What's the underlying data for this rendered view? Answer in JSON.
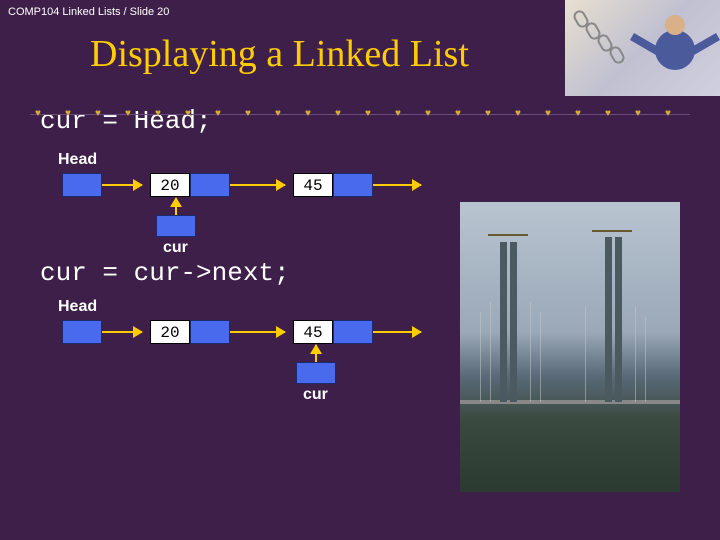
{
  "header": "COMP104 Linked Lists / Slide 20",
  "title": "Displaying a Linked List",
  "code1": "cur = Head;",
  "code2": "cur = cur->next;",
  "diagram1": {
    "headLabel": "Head",
    "node1": "20",
    "node2": "45",
    "curLabel": "cur"
  },
  "diagram2": {
    "headLabel": "Head",
    "node1": "20",
    "node2": "45",
    "curLabel": "cur"
  }
}
